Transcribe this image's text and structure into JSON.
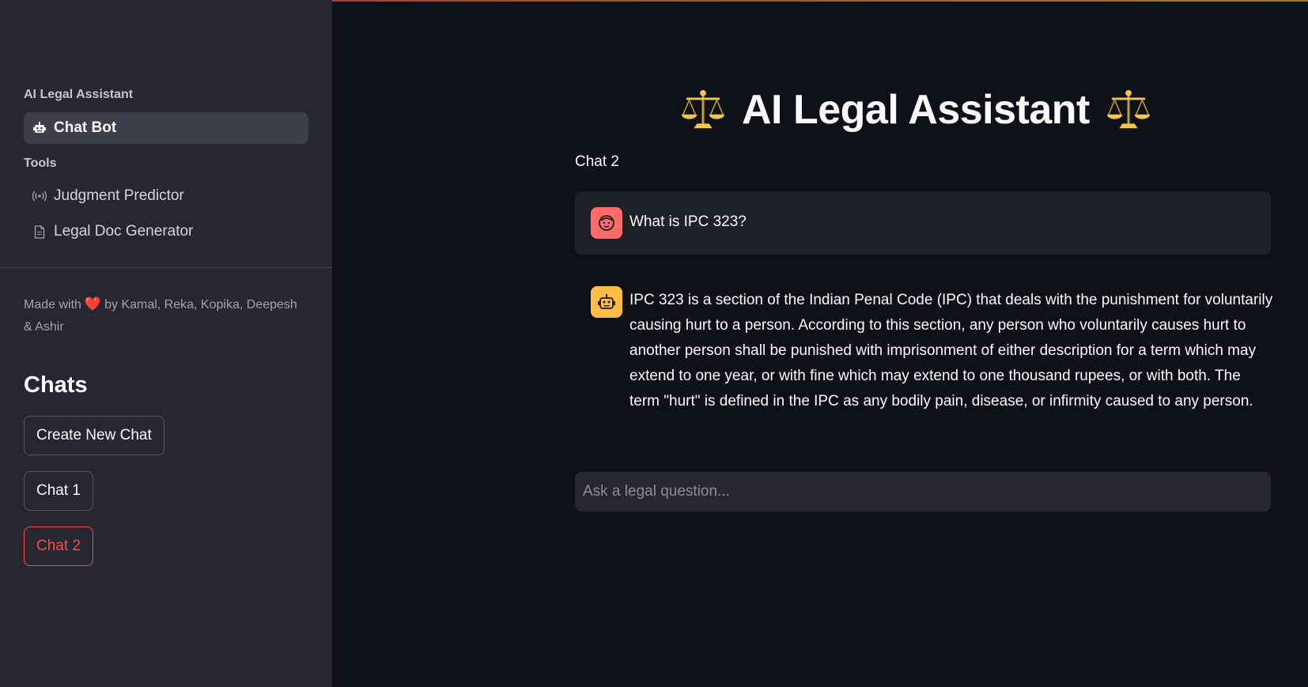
{
  "sidebar": {
    "app_section": "AI Legal Assistant",
    "nav_chatbot": "Chat Bot",
    "tools_section": "Tools",
    "nav_judgment": "Judgment Predictor",
    "nav_docgen": "Legal Doc Generator",
    "credit_prefix": "Made with",
    "credit_heart": "❤️",
    "credit_suffix": "by Kamal, Reka, Kopika, Deepesh & Ashir",
    "chats_heading": "Chats",
    "create_new_chat": "Create New Chat",
    "chat_buttons": [
      "Chat 1",
      "Chat 2"
    ],
    "selected_chat": "Chat 2"
  },
  "main": {
    "title": "AI Legal Assistant",
    "title_icon": "balance-scale-icon",
    "chat_label": "Chat 2",
    "messages": [
      {
        "role": "user",
        "text": "What is IPC 323?"
      },
      {
        "role": "assistant",
        "text": "IPC 323 is a section of the Indian Penal Code (IPC) that deals with the punishment for voluntarily causing hurt to a person. According to this section, any person who voluntarily causes hurt to another person shall be punished with imprisonment of either description for a term which may extend to one year, or with fine which may extend to one thousand rupees, or with both. The term \"hurt\" is defined in the IPC as any bodily pain, disease, or infirmity caused to any person."
      }
    ],
    "input_placeholder": "Ask a legal question..."
  },
  "colors": {
    "background": "#0e1117",
    "sidebar": "#262730",
    "accent": "#ff4b4b",
    "user_avatar": "#ff6b6b",
    "bot_avatar": "#ffbd45"
  }
}
